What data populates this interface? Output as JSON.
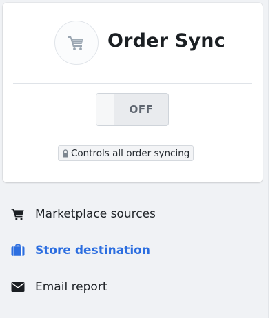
{
  "colors": {
    "accent": "#2c6ee0",
    "text": "#212529",
    "muted": "#5f6670",
    "icon_muted": "#9aa5b1"
  },
  "card": {
    "logo_icon": "shopping-cart-icon",
    "title": "Order Sync",
    "toggle": {
      "state_label": "OFF",
      "is_on": false
    },
    "badge": {
      "icon": "lock-icon",
      "text": "Controls all order syncing"
    }
  },
  "nav": {
    "items": [
      {
        "icon": "cart-icon",
        "label": "Marketplace sources",
        "active": false
      },
      {
        "icon": "briefcase-icon",
        "label": "Store destination",
        "active": true
      },
      {
        "icon": "envelope-icon",
        "label": "Email report",
        "active": false
      }
    ]
  }
}
